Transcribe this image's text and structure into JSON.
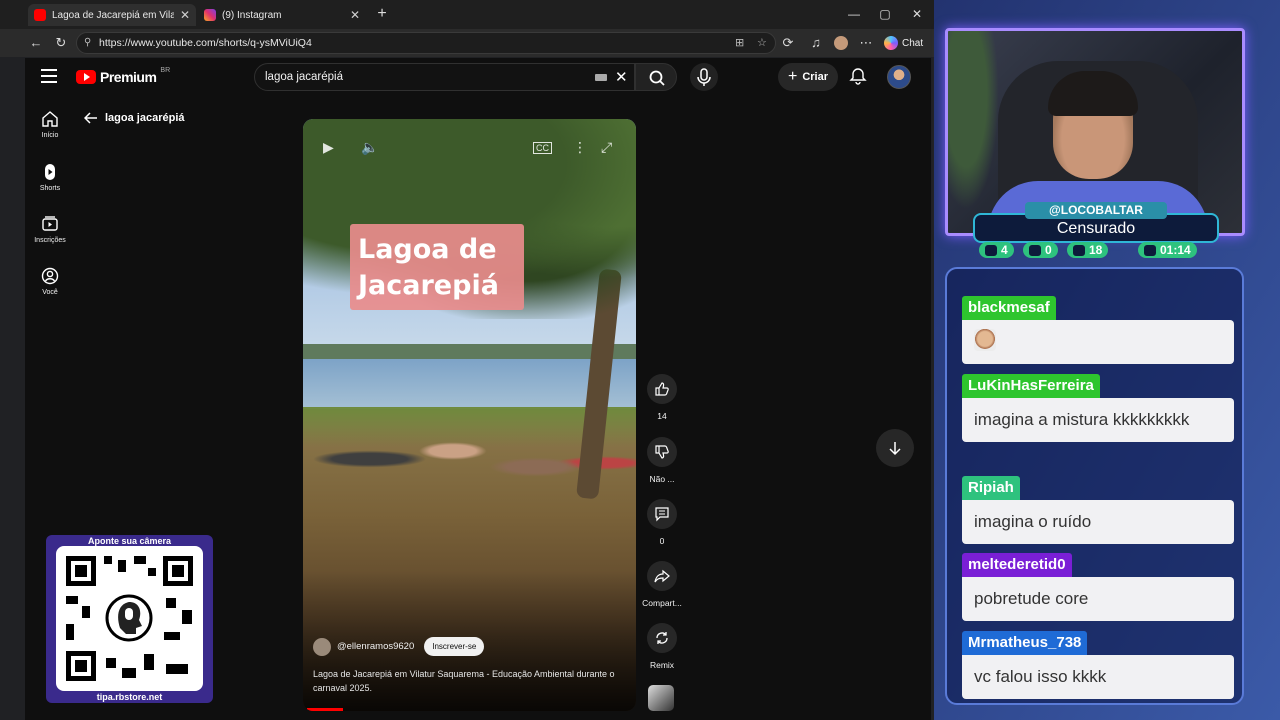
{
  "browser": {
    "tabs": [
      {
        "label": "Lagoa de Jacarepiá em Vilatur Saquarema",
        "favicon_color": "#ff0000",
        "active": true
      },
      {
        "label": "(9) Instagram",
        "favicon_color": "#e1306c",
        "active": false
      }
    ],
    "new_tab_icon": "plus-icon",
    "url": "https://www.youtube.com/shorts/q-ysMViUiQ4",
    "chat_label": "Chat"
  },
  "youtube": {
    "logo_text": "Premium",
    "region": "BR",
    "search_value": "lagoa jacarépiá",
    "create_label": "Criar",
    "sidebar": [
      {
        "label": "Início",
        "icon": "home-icon"
      },
      {
        "label": "Shorts",
        "icon": "shorts-icon"
      },
      {
        "label": "Inscrições",
        "icon": "subscriptions-icon"
      },
      {
        "label": "Você",
        "icon": "you-icon"
      }
    ],
    "back_label": "lagoa jacarépiá",
    "video": {
      "overlay_title": "Lagoa de Jacarepiá",
      "channel": "@ellenramos9620",
      "subscribe_label": "Inscrever-se",
      "description": "Lagoa de Jacarepiá em Vilatur Saquarema - Educação Ambiental durante o carnaval 2025.",
      "progress": 0.11
    },
    "actions": {
      "like_count": "14",
      "dislike_label": "Não ...",
      "comments_count": "0",
      "share_label": "Compart...",
      "remix_label": "Remix"
    },
    "qr": {
      "top_text": "Aponte sua câmera",
      "bottom_text": "tipa.rbstore.net"
    }
  },
  "stream": {
    "streamer": "@LOCOBALTAR",
    "title": "Censurado",
    "stats": {
      "a": "4",
      "b": "0",
      "c": "18",
      "time": "01:14"
    },
    "chat": [
      {
        "user": "blackmesaf",
        "color": "#2ec52e",
        "text": "",
        "emote": "face-emote"
      },
      {
        "user": "LuKinHasFerreira",
        "color": "#2ec52e",
        "text": "imagina a mistura kkkkkkkkk"
      },
      {
        "user": "Ripiah",
        "color": "#2ec27e",
        "text": "imagina o ruído"
      },
      {
        "user": "meltederetid0",
        "color": "#7a1fd6",
        "text": "pobretude core"
      },
      {
        "user": "Mrmatheus_738",
        "color": "#1f6bd6",
        "text": "vc falou isso kkkk"
      }
    ]
  }
}
